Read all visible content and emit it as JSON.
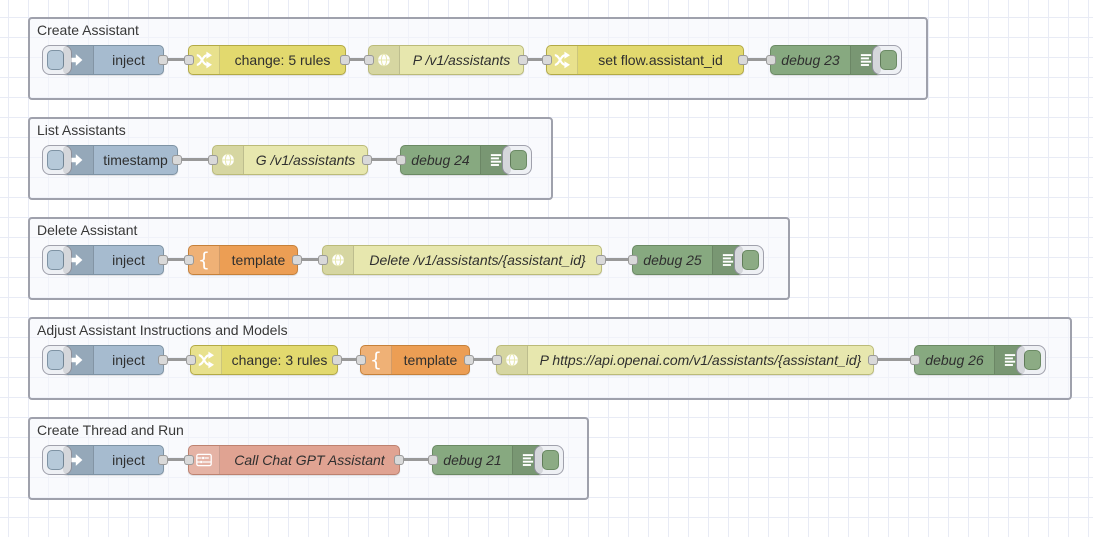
{
  "app": {
    "name": "Node-RED flow editor workspace"
  },
  "canvas": {
    "background": "#ffffff",
    "grid_color": "#e8ebf5",
    "grid_size_px": 20
  },
  "colors": {
    "inject_node": "#a6bbcf",
    "change_node": "#e2d96e",
    "http_request_node": "#e7e7ae",
    "template_node": "#ec9e54",
    "debug_node": "#87a980",
    "subflow_node": "#e0a392",
    "wire": "#999999",
    "port": "#d9d9d9",
    "group_border": "#9fa1ac"
  },
  "groups": [
    {
      "title": "Create Assistant",
      "nodes": [
        {
          "type": "inject",
          "label": "inject",
          "icon": "arrow-in-icon"
        },
        {
          "type": "change",
          "label": "change: 5 rules",
          "icon": "shuffle-icon"
        },
        {
          "type": "http request",
          "label": "P /v1/assistants",
          "icon": "globe-icon"
        },
        {
          "type": "change",
          "label": "set flow.assistant_id",
          "icon": "shuffle-icon"
        },
        {
          "type": "debug",
          "label": "debug 23",
          "icon": "list-icon"
        }
      ]
    },
    {
      "title": "List Assistants",
      "nodes": [
        {
          "type": "inject",
          "label": "timestamp",
          "icon": "arrow-in-icon"
        },
        {
          "type": "http request",
          "label": "G /v1/assistants",
          "icon": "globe-icon"
        },
        {
          "type": "debug",
          "label": "debug 24",
          "icon": "list-icon"
        }
      ]
    },
    {
      "title": "Delete Assistant",
      "nodes": [
        {
          "type": "inject",
          "label": "inject",
          "icon": "arrow-in-icon"
        },
        {
          "type": "template",
          "label": "template",
          "icon": "curly-brace-icon"
        },
        {
          "type": "http request",
          "label": "Delete /v1/assistants/{assistant_id}",
          "icon": "globe-icon"
        },
        {
          "type": "debug",
          "label": "debug 25",
          "icon": "list-icon"
        }
      ]
    },
    {
      "title": "Adjust Assistant Instructions and Models",
      "nodes": [
        {
          "type": "inject",
          "label": "inject",
          "icon": "arrow-in-icon"
        },
        {
          "type": "change",
          "label": "change: 3 rules",
          "icon": "shuffle-icon"
        },
        {
          "type": "template",
          "label": "template",
          "icon": "curly-brace-icon"
        },
        {
          "type": "http request",
          "label": "P https://api.openai.com/v1/assistants/{assistant_id}",
          "icon": "globe-icon"
        },
        {
          "type": "debug",
          "label": "debug 26",
          "icon": "list-icon"
        }
      ]
    },
    {
      "title": "Create Thread and Run",
      "nodes": [
        {
          "type": "inject",
          "label": "inject",
          "icon": "arrow-in-icon"
        },
        {
          "type": "subflow",
          "label": "Call Chat GPT Assistant",
          "icon": "subflow-icon"
        },
        {
          "type": "debug",
          "label": "debug 21",
          "icon": "list-icon"
        }
      ]
    }
  ]
}
